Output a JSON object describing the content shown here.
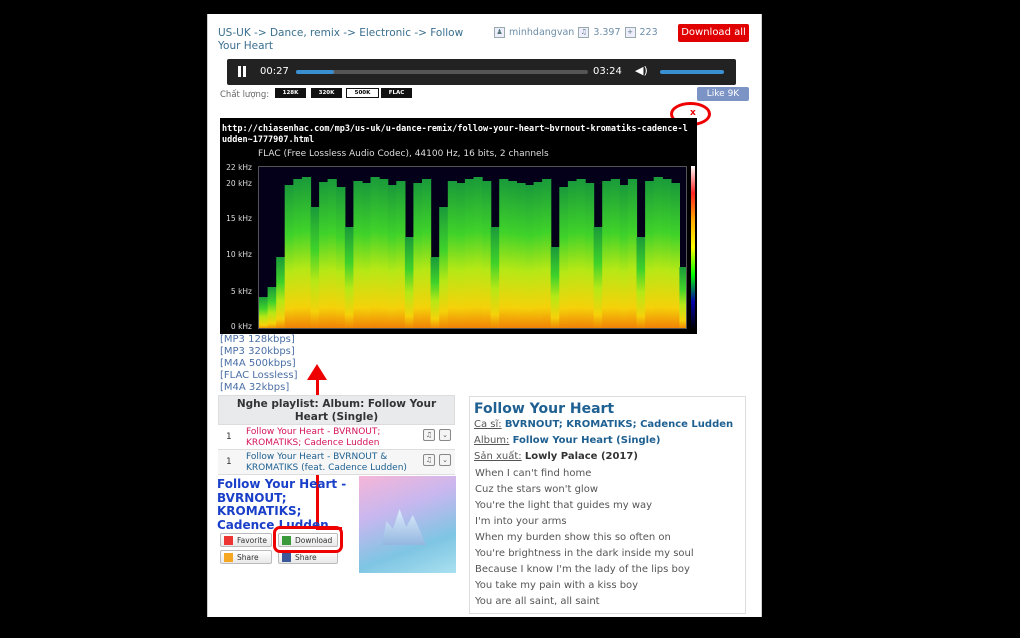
{
  "breadcrumb": {
    "text": "US-UK -> Dance, remix -> Electronic -> Follow Your Heart"
  },
  "uploader": {
    "name": "minhdangvan",
    "listens": "3.397",
    "favorites": "223"
  },
  "download_all": "Download all",
  "player": {
    "current": "00:27",
    "total": "03:24",
    "progress": 0.13
  },
  "quality": {
    "label": "Chất lượng:",
    "options": [
      "128K",
      "320K",
      "500K",
      "FLAC"
    ],
    "selected": "500K"
  },
  "like": "Like 9K",
  "close": "x",
  "spectrum": {
    "url": "http://chiasenhac.com/mp3/us-uk/u-dance-remix/follow-your-heart~bvrnout-kromatiks-cadence-ludden~1777907.html",
    "info": "FLAC (Free Lossless Audio Codec), 44100 Hz, 16 bits, 2 channels",
    "yticks": [
      "22 kHz",
      "20 kHz",
      "15 kHz",
      "10 kHz",
      "5 kHz",
      "0 kHz"
    ]
  },
  "formats": [
    "[MP3 128kbps]",
    "[MP3 320kbps]",
    "[M4A 500kbps]",
    "[FLAC Lossless]",
    "[M4A 32kbps]"
  ],
  "playlist": {
    "header": "Nghe playlist: Album: Follow Your Heart (Single)",
    "rows": [
      {
        "num": "1",
        "title": "Follow Your Heart - BVRNOUT; KROMATIKS; Cadence Ludden"
      },
      {
        "num": "1",
        "title": "Follow Your Heart - BVRNOUT & KROMATIKS (feat. Cadence Ludden)"
      }
    ]
  },
  "song_big_title": "Follow Your Heart - BVRNOUT; KROMATIKS; Cadence Ludden",
  "actions": {
    "favorite": "Favorite",
    "download": "Download",
    "share1": "Share",
    "share2": "Share"
  },
  "info": {
    "title": "Follow Your Heart",
    "artist_label": "Ca sĩ:",
    "artists": "BVRNOUT; KROMATIKS; Cadence Ludden",
    "album_label": "Album:",
    "album": "Follow Your Heart (Single)",
    "producer_label": "Sản xuất:",
    "producer": "Lowly Palace (2017)"
  },
  "lyrics": [
    "When I can't find home",
    "Cuz the stars won't glow",
    "You're the light that guides my way",
    "I'm into your arms",
    "When my burden show this so often on",
    "You're brightness in the dark inside my soul",
    "Because I know I'm the lady of the lips boy",
    "You take my pain with a kiss boy",
    "You are all saint, all saint"
  ]
}
